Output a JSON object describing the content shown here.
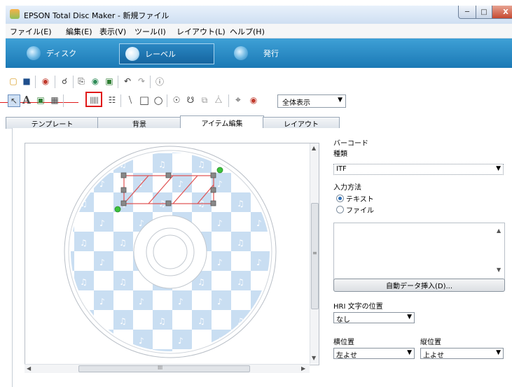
{
  "window": {
    "title": "EPSON Total Disc Maker - 新規ファイル",
    "min_symbol": "─",
    "max_symbol": "□",
    "close_symbol": "X"
  },
  "menu": [
    "ファイル(E)",
    "編集(E)",
    "表示(V)",
    "ツール(I)",
    "レイアウト(L)",
    "ヘルプ(H)"
  ],
  "nav": {
    "disc": "ディスク",
    "label": "レーベル",
    "publish": "発行"
  },
  "toolbar2": {
    "text_tool": "A",
    "zoom_select": "全体表示",
    "zoom_arrow": "▼"
  },
  "tabs": [
    "テンプレート",
    "背景",
    "アイテム編集",
    "レイアウト"
  ],
  "active_tab": "アイテム編集",
  "panel": {
    "heading": "バーコード",
    "type_label": "種類",
    "type_value": "ITF",
    "input_method_label": "入力方法",
    "option_text": "テキスト",
    "option_file": "ファイル",
    "selected_option": "テキスト",
    "auto_insert_button": "自動データ挿入(D)...",
    "hri_label": "HRI 文字の位置",
    "hri_value": "なし",
    "h_pos_label": "横位置",
    "h_pos_value": "左よせ",
    "v_pos_label": "縦位置",
    "v_pos_value": "上よせ",
    "dropdown_arrow": "▼"
  },
  "scroll": {
    "hscroll_mark": "III",
    "vscroll_mark": "≡"
  },
  "colors": {
    "nav_blue": "#1b79b5",
    "highlight_red": "#e01818",
    "disc_tile_blue": "#c9def2"
  }
}
